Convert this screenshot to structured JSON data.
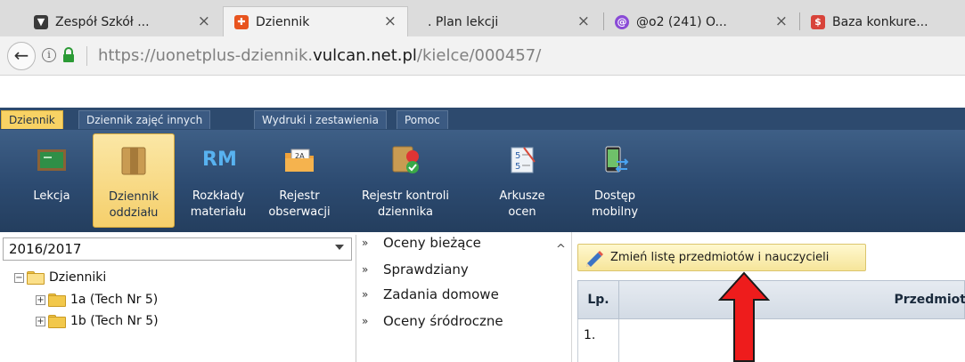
{
  "browser": {
    "tabs": [
      {
        "title": "Zespół Szkół ...",
        "icon": "shield-icon",
        "color": "#3a3a3a",
        "active": false
      },
      {
        "title": "Dziennik",
        "icon": "vulcan-icon",
        "color": "#e8541f",
        "active": true
      },
      {
        "title": ". Plan lekcji",
        "icon": "",
        "color": "",
        "active": false
      },
      {
        "title": "@o2 (241) O...",
        "icon": "o2-icon",
        "color": "#8a4bd6",
        "active": false
      },
      {
        "title": "Baza konkure...",
        "icon": "bookmark-icon",
        "color": "#d8433a",
        "active": false
      }
    ],
    "close_glyph": "×",
    "url": {
      "prefix": "https://uonetplus-dziennik.",
      "domain": "vulcan.net.pl",
      "suffix": "/kielce/000457/"
    }
  },
  "app": {
    "menu": [
      {
        "label": "Dziennik",
        "active": true
      },
      {
        "label": "Dziennik zajęć innych",
        "active": false
      },
      {
        "label": "Wydruki i zestawienia",
        "active": false
      },
      {
        "label": "Pomoc",
        "active": false
      }
    ],
    "toolbar": [
      {
        "label1": "Lekcja",
        "label2": "",
        "icon": "lesson-icon",
        "selected": false
      },
      {
        "label1": "Dziennik",
        "label2": "oddziału",
        "icon": "class-journal-icon",
        "selected": true
      },
      {
        "label1": "Rozkłady",
        "label2": "materiału",
        "icon": "rm-icon",
        "icon_text": "RM",
        "selected": false
      },
      {
        "label1": "Rejestr",
        "label2": "obserwacji",
        "icon": "observation-register-icon",
        "selected": false
      },
      {
        "label1": "Rejestr kontroli",
        "label2": "dziennika",
        "icon": "journal-control-icon",
        "selected": false
      },
      {
        "label1": "Arkusze",
        "label2": "ocen",
        "icon": "grade-sheets-icon",
        "selected": false
      },
      {
        "label1": "Dostęp",
        "label2": "mobilny",
        "icon": "mobile-access-icon",
        "selected": false
      }
    ],
    "left": {
      "year": "2016/2017",
      "tree": [
        {
          "label": "Dzienniki",
          "expander": "⊟"
        },
        {
          "label": "1a (Tech Nr 5)",
          "expander": "⊞"
        },
        {
          "label": "1b (Tech Nr 5)",
          "expander": "⊞"
        }
      ]
    },
    "middle": {
      "chevron": "»",
      "items": [
        "Oceny bieżące",
        "Sprawdziany",
        "Zadania domowe",
        "Oceny śródroczne"
      ]
    },
    "right": {
      "change_button": "Zmień listę przedmiotów i nauczycieli",
      "table": {
        "headers": [
          "Lp.",
          "Przedmiot"
        ],
        "rows": [
          [
            "1."
          ]
        ]
      }
    }
  }
}
